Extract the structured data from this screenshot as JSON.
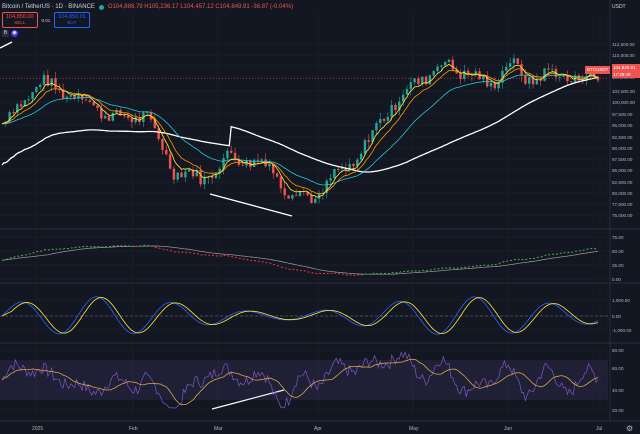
{
  "header": {
    "symbol": "Bitcoin / TetherUS · 1D · BINANCE",
    "ohlc": "O104,886.79  H105,236.17  L104,457.12  C104,849.91  -36.87 (-0.04%)",
    "currency": "USDT"
  },
  "orders": {
    "sell_price": "104,850.00",
    "sell_label": "SELL",
    "spread": "0.01",
    "buy_price": "104,850.01",
    "buy_label": "BUY"
  },
  "controls": {
    "b": "B",
    "eye": "◉"
  },
  "price_tag": {
    "symbol": "BTCUSDT",
    "price": "104,849.91",
    "countdown": "17:45:49"
  },
  "axes": {
    "main_ticks": [
      "112,500.00",
      "110,000.00",
      "107,500.00",
      "105,000.00",
      "102,500.00",
      "100,000.00",
      "97,500.00",
      "95,000.00",
      "92,500.00",
      "90,000.00",
      "87,500.00",
      "85,000.00",
      "82,500.00",
      "80,000.00",
      "77,500.00",
      "75,000.00"
    ],
    "osc1_ticks": [
      "75.00",
      "50.00",
      "25.00",
      "0.00"
    ],
    "osc2_ticks": [
      "1,000.00",
      "0.00",
      "-1,000.00"
    ],
    "rsi_ticks": [
      "80.00",
      "60.00",
      "40.00",
      "20.00"
    ],
    "time_labels": [
      "2025",
      "Feb",
      "Mar",
      "Apr",
      "May",
      "Jun",
      "Jul"
    ]
  },
  "colors": {
    "bg": "#131722",
    "up": "#26a69a",
    "down": "#ef5350",
    "grid": "#1e222d",
    "ema_fast": "#ffeb3b",
    "ema_mid": "#ff9800",
    "ema_slow": "#26c6da",
    "sma_long": "#ffffff",
    "macd": "#2962ff",
    "signal": "#ffeb3b",
    "rsi": "#7e57c2",
    "rsi_ma": "#d4a64a"
  }
}
